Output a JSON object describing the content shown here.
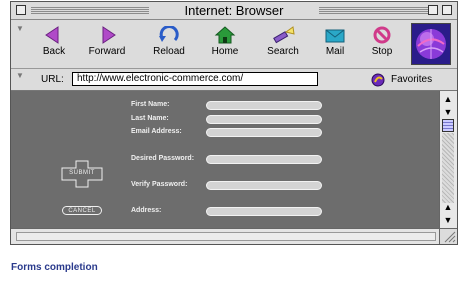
{
  "window": {
    "title": "Internet: Browser"
  },
  "toolbar": {
    "buttons": [
      {
        "label": "Back",
        "icon": "back-arrow-icon",
        "color": "#b04ac8"
      },
      {
        "label": "Forward",
        "icon": "forward-arrow-icon",
        "color": "#b04ac8"
      },
      {
        "label": "Reload",
        "icon": "reload-icon",
        "color": "#2a5cc8"
      },
      {
        "label": "Home",
        "icon": "home-icon",
        "color": "#2a9a3a"
      },
      {
        "label": "Search",
        "icon": "search-flashlight-icon",
        "color": "#8a5cc8"
      },
      {
        "label": "Mail",
        "icon": "mail-icon",
        "color": "#2aa8c8"
      },
      {
        "label": "Stop",
        "icon": "stop-icon",
        "color": "#d03a8a"
      }
    ],
    "logo_icon": "globe-logo-icon"
  },
  "urlbar": {
    "label": "URL:",
    "value": "http://www.electronic-commerce.com/",
    "favorites_label": "Favorites",
    "favorites_icon": "favorites-icon"
  },
  "form": {
    "fields": [
      {
        "label": "First Name:"
      },
      {
        "label": "Last Name:"
      },
      {
        "label": "Email Address:"
      },
      {
        "label": "Desired Password:"
      },
      {
        "label": "Verify Password:"
      },
      {
        "label": "Address:"
      }
    ],
    "submit_label": "SUBMIT",
    "cancel_label": "CANCEL"
  },
  "caption": "Forms completion",
  "colors": {
    "content_bg": "#6d6d6d",
    "caption": "#2a3a8c"
  }
}
